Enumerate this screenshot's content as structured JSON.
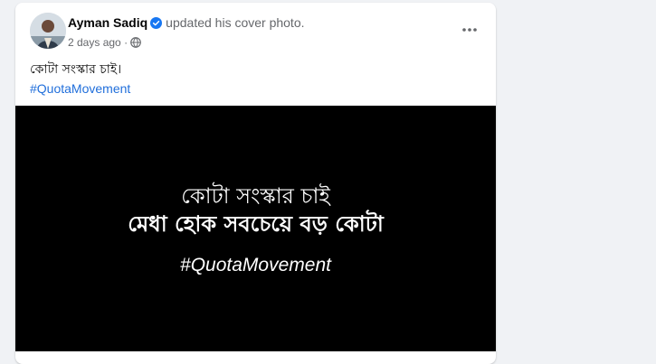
{
  "post": {
    "author_name": "Ayman Sadiq",
    "action_text": "updated his cover photo.",
    "timestamp": "2 days ago",
    "separator": "·",
    "privacy_icon": "globe-icon",
    "verified_icon": "verified-badge-icon",
    "more_icon": "more-horizontal-icon",
    "caption": "কোটা সংস্কার চাই।",
    "hashtag": "#QuotaMovement",
    "accent_color": "#1877f2",
    "link_color": "#216fdb"
  },
  "cover_image": {
    "line1": "কোটা সংস্কার চাই",
    "line2": "মেধা হোক সবচেয়ে বড় কোটা",
    "hashtag": "#QuotaMovement",
    "background_color": "#000000",
    "text_color": "#ffffff"
  }
}
